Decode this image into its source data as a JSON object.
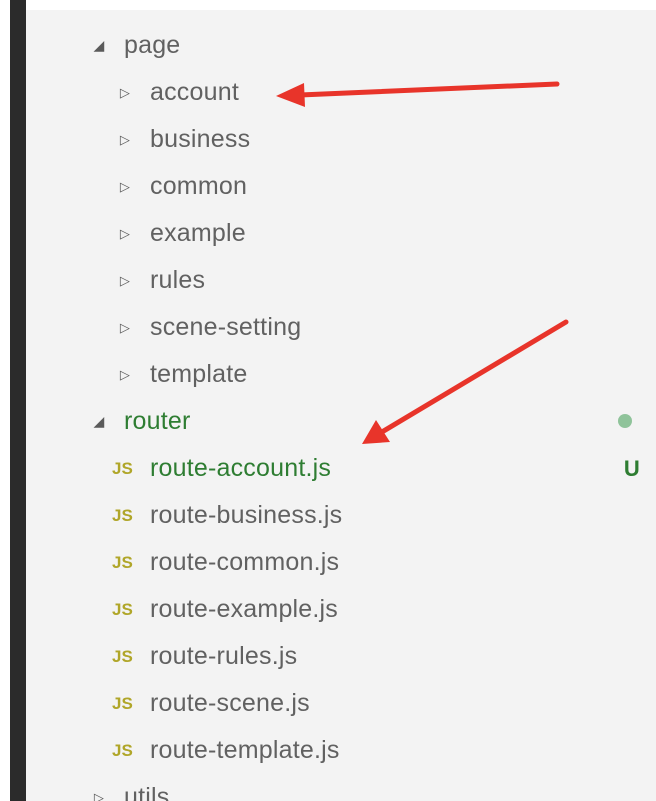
{
  "tree": {
    "page_folder": {
      "label": "page",
      "expanded": true
    },
    "page_children": [
      {
        "label": "account"
      },
      {
        "label": "business"
      },
      {
        "label": "common"
      },
      {
        "label": "example"
      },
      {
        "label": "rules"
      },
      {
        "label": "scene-setting"
      },
      {
        "label": "template"
      }
    ],
    "router_folder": {
      "label": "router",
      "expanded": true,
      "status": "modified-dot"
    },
    "router_children": [
      {
        "label": "route-account.js",
        "icon": "JS",
        "status": "U"
      },
      {
        "label": "route-business.js",
        "icon": "JS"
      },
      {
        "label": "route-common.js",
        "icon": "JS"
      },
      {
        "label": "route-example.js",
        "icon": "JS"
      },
      {
        "label": "route-rules.js",
        "icon": "JS"
      },
      {
        "label": "route-scene.js",
        "icon": "JS"
      },
      {
        "label": "route-template.js",
        "icon": "JS"
      }
    ],
    "utils_folder": {
      "label": "utils",
      "expanded": false
    }
  },
  "icons": {
    "expanded": "caret-down-icon",
    "collapsed": "caret-right-icon",
    "js_file": "js-file-icon"
  },
  "colors": {
    "text": "#616161",
    "untracked_green": "#2e7d32",
    "js_icon": "#b0a629",
    "annotation_arrow": "#e8342a"
  }
}
